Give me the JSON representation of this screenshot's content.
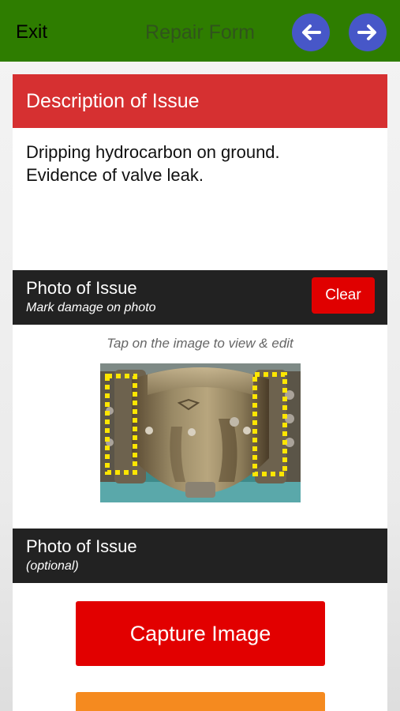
{
  "nav": {
    "exit_label": "Exit",
    "title": "Repair Form",
    "back_icon": "arrow-left-icon",
    "next_icon": "arrow-right-icon",
    "bar_color": "#2e7d00",
    "circle_color": "#4757c8"
  },
  "description": {
    "header": "Description of Issue",
    "line1": "Dripping hydrocarbon on ground.",
    "line2": "Evidence of valve leak.",
    "header_color": "#d63031"
  },
  "photo_section": {
    "title": "Photo of Issue",
    "subtitle": "Mark damage on photo",
    "clear_label": "Clear",
    "hint": "Tap on the image to view & edit"
  },
  "photo_optional": {
    "title": "Photo of Issue",
    "subtitle": "(optional)"
  },
  "actions": {
    "capture_label": "Capture Image",
    "capture_color": "#e20000",
    "secondary_color": "#f58a1f"
  }
}
